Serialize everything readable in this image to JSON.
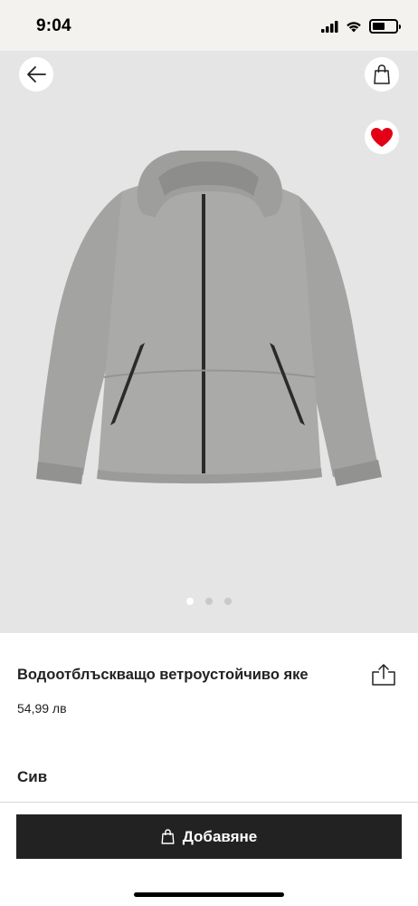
{
  "status_bar": {
    "time": "9:04"
  },
  "hero": {
    "image_subject": "grey hooded windbreaker jacket",
    "image_count": 3,
    "active_image_index": 0
  },
  "product": {
    "title": "Водоотблъскващо ветроустойчиво яке",
    "price": "54,99 лв",
    "color": "Сив"
  },
  "actions": {
    "add_label": "Добавяне"
  },
  "icons": {
    "back": "arrow-left-icon",
    "bag": "shopping-bag-icon",
    "favorite": "heart-icon",
    "share": "share-icon"
  },
  "colors": {
    "favorite": "#e30016",
    "button": "#222222",
    "hero_bg": "#e5e5e6"
  }
}
